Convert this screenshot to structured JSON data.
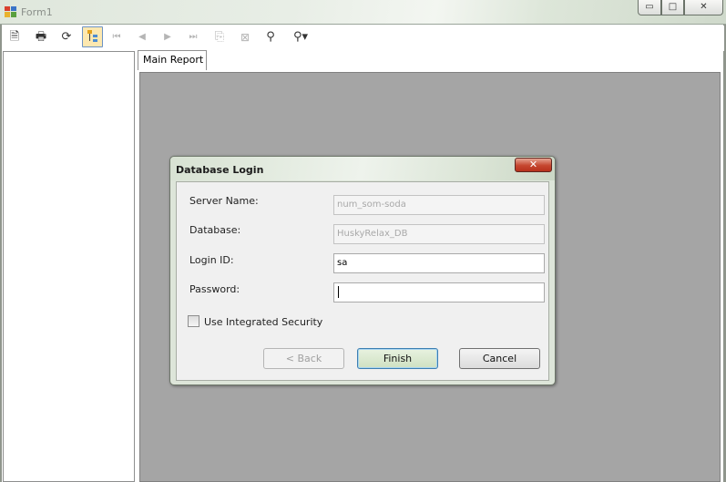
{
  "window": {
    "title": "Form1",
    "caption_buttons": {
      "minimize": "▭",
      "maximize": "□",
      "close": "✕"
    }
  },
  "toolbar": {
    "items": [
      {
        "name": "export-icon",
        "glyph": "🗎"
      },
      {
        "name": "print-icon",
        "glyph": "🖶"
      },
      {
        "name": "refresh-icon",
        "glyph": "⟳"
      },
      {
        "name": "group-tree-toggle-icon",
        "glyph": ""
      },
      {
        "name": "first-page-icon",
        "glyph": "⏮"
      },
      {
        "name": "previous-page-icon",
        "glyph": "◀"
      },
      {
        "name": "next-page-icon",
        "glyph": "▶"
      },
      {
        "name": "last-page-icon",
        "glyph": "⏭"
      },
      {
        "name": "go-to-page-icon",
        "glyph": "⎘"
      },
      {
        "name": "stop-icon",
        "glyph": "⊠"
      },
      {
        "name": "find-icon",
        "glyph": "⚲"
      },
      {
        "name": "zoom-icon",
        "glyph": "⚲▾"
      }
    ]
  },
  "tabs": {
    "main_report": "Main Report"
  },
  "dialog": {
    "title": "Database Login",
    "close_glyph": "✕",
    "server_name_label": "Server Name:",
    "server_name_value": "num_som-soda",
    "database_label": "Database:",
    "database_value": "HuskyRelax_DB",
    "login_id_label": "Login ID:",
    "login_id_value": "sa",
    "password_label": "Password:",
    "password_value": "",
    "integrated_security_label": "Use Integrated Security",
    "integrated_security_checked": false,
    "back_button": "< Back",
    "finish_button": "Finish",
    "cancel_button": "Cancel"
  }
}
